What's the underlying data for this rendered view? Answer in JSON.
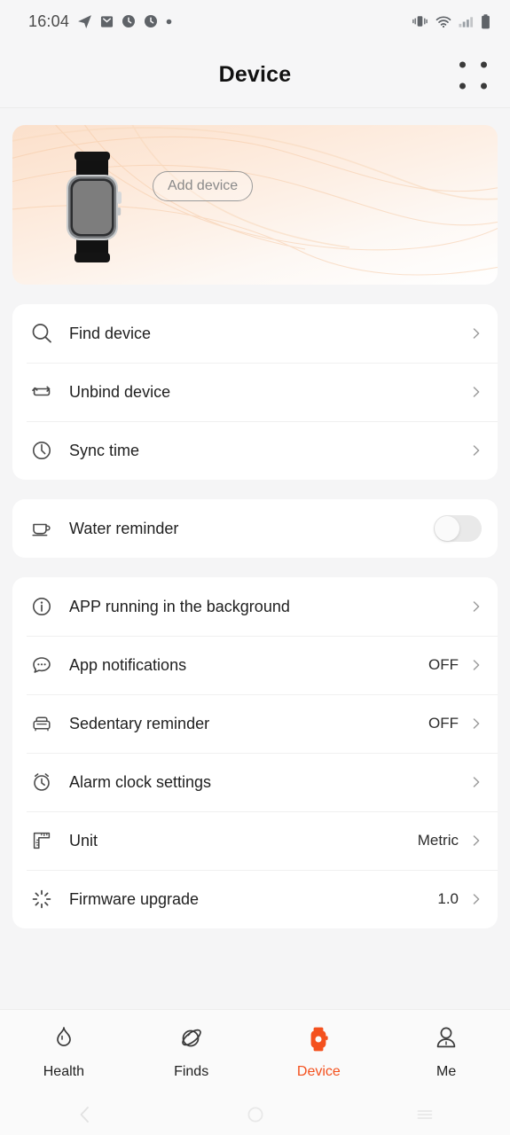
{
  "statusbar": {
    "time": "16:04",
    "left_icons": [
      "telegram-plane-icon",
      "mail-icon",
      "clock-icon",
      "clock-icon",
      "dot-icon"
    ],
    "right_icons": [
      "vibrate-icon",
      "wifi-icon",
      "signal-icon",
      "battery-icon"
    ]
  },
  "header": {
    "title": "Device",
    "menu_icon": "grid-menu-icon"
  },
  "device_card": {
    "add_device_label": "Add device",
    "device_image": "smartwatch-image",
    "accent": "#fbe0cb"
  },
  "groups": [
    {
      "rows": [
        {
          "icon": "search-icon",
          "label": "Find device",
          "value": "",
          "chevron": true
        },
        {
          "icon": "unbind-icon",
          "label": "Unbind device",
          "value": "",
          "chevron": true
        },
        {
          "icon": "clock-icon",
          "label": "Sync time",
          "value": "",
          "chevron": true
        }
      ]
    },
    {
      "rows": [
        {
          "icon": "cup-icon",
          "label": "Water reminder",
          "value": "",
          "toggle": "off"
        }
      ]
    },
    {
      "rows": [
        {
          "icon": "info-icon",
          "label": "APP running in the background",
          "value": "",
          "chevron": true
        },
        {
          "icon": "chat-icon",
          "label": "App notifications",
          "value": "OFF",
          "chevron": true
        },
        {
          "icon": "sofa-icon",
          "label": "Sedentary reminder",
          "value": "OFF",
          "chevron": true
        },
        {
          "icon": "alarm-icon",
          "label": "Alarm clock settings",
          "value": "",
          "chevron": true
        },
        {
          "icon": "ruler-icon",
          "label": "Unit",
          "value": "Metric",
          "chevron": true
        },
        {
          "icon": "spinner-icon",
          "label": "Firmware upgrade",
          "value": "1.0",
          "chevron": true
        }
      ]
    }
  ],
  "bottomnav": {
    "active_color": "#f4511e",
    "items": [
      {
        "icon": "flame-icon",
        "label": "Health",
        "active": false
      },
      {
        "icon": "planet-icon",
        "label": "Finds",
        "active": false
      },
      {
        "icon": "watch-icon",
        "label": "Device",
        "active": true
      },
      {
        "icon": "person-icon",
        "label": "Me",
        "active": false
      }
    ]
  },
  "sysnav": {
    "back": "back-chevron-icon",
    "home": "home-circle-icon",
    "recents": "recents-icon"
  }
}
